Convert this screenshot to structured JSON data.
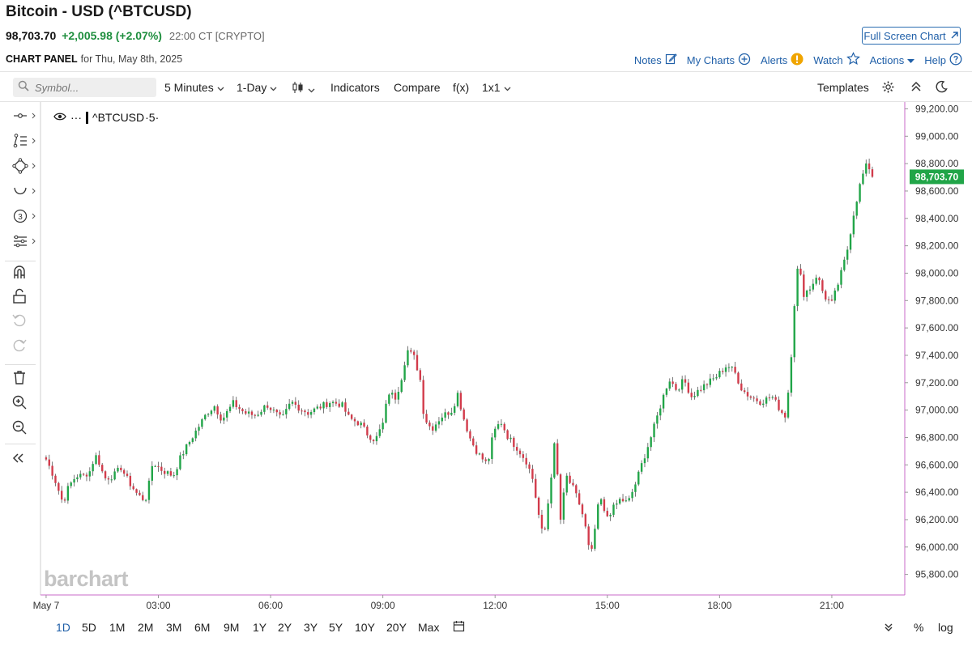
{
  "header": {
    "title": "Bitcoin - USD (^BTCUSD)",
    "last": "98,703.70",
    "change": "+2,005.98 (+2.07%)",
    "time": "22:00 CT [CRYPTO]",
    "fullscreen": "Full Screen Chart"
  },
  "panel": {
    "label": "CHART PANEL",
    "date": "for Thu, May 8th, 2025"
  },
  "links": {
    "notes": "Notes",
    "mycharts": "My Charts",
    "alerts": "Alerts",
    "watch": "Watch",
    "actions": "Actions",
    "help": "Help"
  },
  "toolbar": {
    "symbol_placeholder": "Symbol...",
    "interval": "5 Minutes",
    "range": "1-Day",
    "indicators": "Indicators",
    "compare": "Compare",
    "fx": "f(x)",
    "layout": "1x1",
    "templates": "Templates"
  },
  "legend": {
    "symbol": "^BTCUSD",
    "interval": "·5·"
  },
  "watermark": "barchart",
  "ranges": [
    "1D",
    "5D",
    "1M",
    "2M",
    "3M",
    "6M",
    "9M",
    "1Y",
    "2Y",
    "3Y",
    "5Y",
    "10Y",
    "20Y",
    "Max"
  ],
  "active_range": "1D",
  "bottom_right": {
    "pct": "%",
    "log": "log"
  },
  "colors": {
    "up": "#21a548",
    "down": "#d23b4b",
    "accent": "#1f5fa8",
    "price_badge": "#21a548",
    "axis_line": "#c86ac8"
  },
  "chart_data": {
    "type": "candlestick",
    "title": "^BTCUSD",
    "ylim": [
      95650,
      99250
    ],
    "y_ticks": [
      99200,
      99000,
      98800,
      98600,
      98400,
      98200,
      98000,
      97800,
      97600,
      97400,
      97200,
      97000,
      96800,
      96600,
      96400,
      96200,
      96000,
      95800
    ],
    "x_tick_labels": [
      {
        "label": "May 7",
        "time": "00:00"
      },
      {
        "label": "03:00",
        "time": "03:00"
      },
      {
        "label": "06:00",
        "time": "06:00"
      },
      {
        "label": "09:00",
        "time": "09:00"
      },
      {
        "label": "12:00",
        "time": "12:00"
      },
      {
        "label": "15:00",
        "time": "15:00"
      },
      {
        "label": "18:00",
        "time": "18:00"
      },
      {
        "label": "21:00",
        "time": "21:00"
      }
    ],
    "x_range_hours": [
      -0.15,
      22.95
    ],
    "bar_interval_minutes": 5,
    "last_price": 98703.7,
    "last_price_label": "98,703.70",
    "close_path_anchors": [
      [
        0.0,
        96640
      ],
      [
        0.2,
        96520
      ],
      [
        0.35,
        96400
      ],
      [
        0.45,
        96320
      ],
      [
        0.6,
        96440
      ],
      [
        0.8,
        96520
      ],
      [
        1.0,
        96520
      ],
      [
        1.2,
        96560
      ],
      [
        1.3,
        96680
      ],
      [
        1.45,
        96600
      ],
      [
        1.55,
        96500
      ],
      [
        1.8,
        96520
      ],
      [
        2.0,
        96580
      ],
      [
        2.2,
        96480
      ],
      [
        2.45,
        96380
      ],
      [
        2.65,
        96340
      ],
      [
        2.75,
        96460
      ],
      [
        2.85,
        96620
      ],
      [
        3.1,
        96560
      ],
      [
        3.4,
        96520
      ],
      [
        3.6,
        96660
      ],
      [
        3.9,
        96800
      ],
      [
        4.3,
        96980
      ],
      [
        4.5,
        97030
      ],
      [
        4.7,
        96930
      ],
      [
        5.0,
        97050
      ],
      [
        5.3,
        96980
      ],
      [
        5.6,
        96960
      ],
      [
        5.9,
        97040
      ],
      [
        6.3,
        96930
      ],
      [
        6.55,
        97060
      ],
      [
        6.8,
        97010
      ],
      [
        7.0,
        96980
      ],
      [
        7.3,
        97020
      ],
      [
        7.6,
        97060
      ],
      [
        7.9,
        97040
      ],
      [
        8.1,
        96940
      ],
      [
        8.4,
        96900
      ],
      [
        8.6,
        96820
      ],
      [
        8.8,
        96780
      ],
      [
        9.0,
        96900
      ],
      [
        9.15,
        97130
      ],
      [
        9.35,
        97090
      ],
      [
        9.5,
        97240
      ],
      [
        9.65,
        97440
      ],
      [
        9.85,
        97380
      ],
      [
        10.0,
        97220
      ],
      [
        10.1,
        96950
      ],
      [
        10.3,
        96860
      ],
      [
        10.55,
        96950
      ],
      [
        10.85,
        97000
      ],
      [
        11.0,
        97120
      ],
      [
        11.15,
        96950
      ],
      [
        11.35,
        96780
      ],
      [
        11.55,
        96680
      ],
      [
        11.8,
        96600
      ],
      [
        11.95,
        96830
      ],
      [
        12.15,
        96920
      ],
      [
        12.35,
        96800
      ],
      [
        12.6,
        96720
      ],
      [
        12.85,
        96620
      ],
      [
        13.0,
        96500
      ],
      [
        13.2,
        96180
      ],
      [
        13.3,
        96050
      ],
      [
        13.45,
        96400
      ],
      [
        13.6,
        96780
      ],
      [
        13.75,
        96200
      ],
      [
        13.9,
        96520
      ],
      [
        14.1,
        96420
      ],
      [
        14.3,
        96280
      ],
      [
        14.45,
        96100
      ],
      [
        14.55,
        95900
      ],
      [
        14.65,
        96100
      ],
      [
        14.8,
        96380
      ],
      [
        14.95,
        96210
      ],
      [
        15.15,
        96280
      ],
      [
        15.35,
        96350
      ],
      [
        15.55,
        96320
      ],
      [
        15.75,
        96460
      ],
      [
        15.95,
        96630
      ],
      [
        16.2,
        96830
      ],
      [
        16.45,
        97060
      ],
      [
        16.65,
        97230
      ],
      [
        16.85,
        97150
      ],
      [
        17.05,
        97220
      ],
      [
        17.25,
        97100
      ],
      [
        17.55,
        97170
      ],
      [
        17.9,
        97240
      ],
      [
        18.2,
        97330
      ],
      [
        18.4,
        97280
      ],
      [
        18.6,
        97150
      ],
      [
        18.8,
        97100
      ],
      [
        19.1,
        97060
      ],
      [
        19.4,
        97100
      ],
      [
        19.65,
        96990
      ],
      [
        19.75,
        96960
      ],
      [
        19.88,
        97230
      ],
      [
        19.98,
        97720
      ],
      [
        20.1,
        98070
      ],
      [
        20.25,
        97850
      ],
      [
        20.45,
        97900
      ],
      [
        20.6,
        97990
      ],
      [
        20.8,
        97830
      ],
      [
        21.0,
        97780
      ],
      [
        21.2,
        97950
      ],
      [
        21.4,
        98150
      ],
      [
        21.6,
        98460
      ],
      [
        21.8,
        98700
      ],
      [
        21.95,
        98800
      ],
      [
        22.1,
        98710
      ]
    ]
  }
}
